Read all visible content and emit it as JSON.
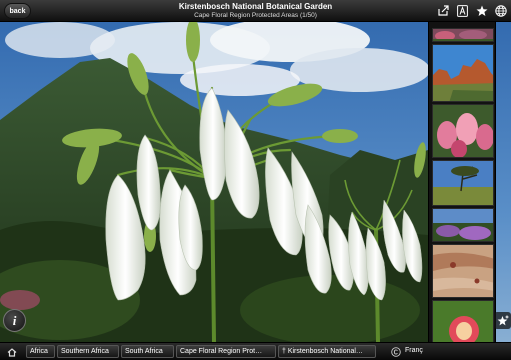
{
  "header": {
    "back_label": "back",
    "title": "Kirstenbosch National Botanical Garden",
    "subtitle": "Cape Floral Region Protected Areas (1/50)"
  },
  "toolbar": {
    "icons": [
      "share-icon",
      "font-icon",
      "star-icon",
      "globe-icon"
    ]
  },
  "thumbnails": [
    {
      "name": "flowers-top-strip"
    },
    {
      "name": "rock-formations"
    },
    {
      "name": "pink-proteas"
    },
    {
      "name": "tree-landscape"
    },
    {
      "name": "purple-flowers"
    },
    {
      "name": "rock-paintings"
    },
    {
      "name": "king-protea"
    },
    {
      "name": "bottom-strip"
    }
  ],
  "breadcrumbs": [
    {
      "label": "Africa"
    },
    {
      "label": "Southern Africa"
    },
    {
      "label": "South Africa"
    },
    {
      "label": "Cape Floral Region Prot…"
    },
    {
      "label": "† Kirstenbosch National…"
    }
  ],
  "language": {
    "label": "Franç"
  },
  "colors": {
    "sky": "#3f78b8",
    "mountain": "#2f4a28",
    "flower": "#f2f2ec",
    "stem": "#5d8a2c"
  }
}
